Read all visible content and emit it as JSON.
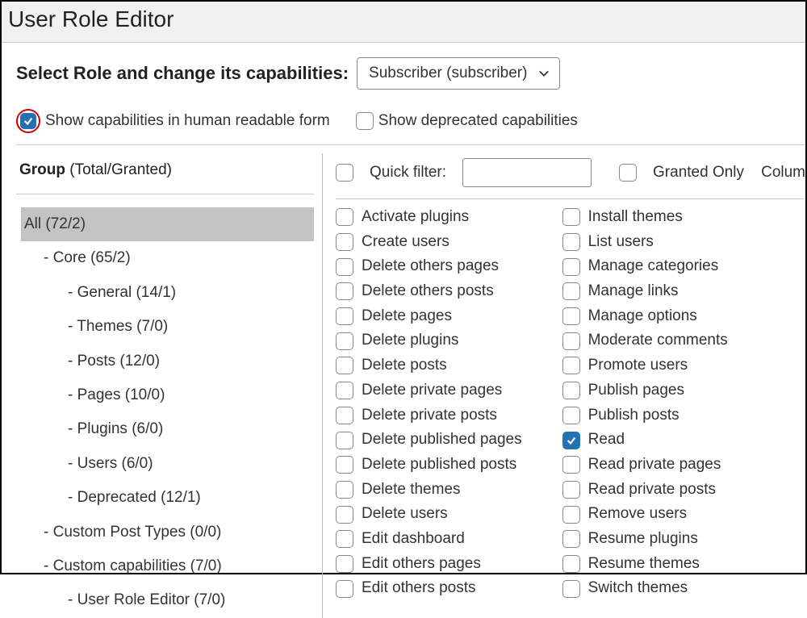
{
  "title": "User Role Editor",
  "roleRow": {
    "label": "Select Role and change its capabilities:",
    "selected": "Subscriber (subscriber)"
  },
  "options": {
    "humanReadable": {
      "label": "Show capabilities in human readable form",
      "checked": true,
      "highlight": true
    },
    "deprecated": {
      "label": "Show deprecated capabilities",
      "checked": false
    }
  },
  "sidebar": {
    "headingBold": "Group",
    "headingLight": " (Total/Granted)",
    "items": [
      {
        "label": "All (72/2)",
        "indent": 0,
        "selected": true
      },
      {
        "label": "- Core (65/2)",
        "indent": 1
      },
      {
        "label": "- General (14/1)",
        "indent": 2
      },
      {
        "label": "- Themes (7/0)",
        "indent": 2
      },
      {
        "label": "- Posts (12/0)",
        "indent": 2
      },
      {
        "label": "- Pages (10/0)",
        "indent": 2
      },
      {
        "label": "- Plugins (6/0)",
        "indent": 2
      },
      {
        "label": "- Users (6/0)",
        "indent": 2
      },
      {
        "label": "- Deprecated (12/1)",
        "indent": 2
      },
      {
        "label": "- Custom Post Types (0/0)",
        "indent": 1
      },
      {
        "label": "- Custom capabilities (7/0)",
        "indent": 1
      },
      {
        "label": "- User Role Editor (7/0)",
        "indent": 2
      }
    ]
  },
  "capsHeader": {
    "selectAllChecked": false,
    "quickFilterLabel": "Quick filter:",
    "quickFilterValue": "",
    "grantedOnlyChecked": false,
    "grantedOnlyLabel": "Granted Only",
    "columnsLabel": "Colum"
  },
  "capabilities": {
    "col1": [
      {
        "label": "Activate plugins",
        "checked": false
      },
      {
        "label": "Create users",
        "checked": false
      },
      {
        "label": "Delete others pages",
        "checked": false
      },
      {
        "label": "Delete others posts",
        "checked": false
      },
      {
        "label": "Delete pages",
        "checked": false
      },
      {
        "label": "Delete plugins",
        "checked": false
      },
      {
        "label": "Delete posts",
        "checked": false
      },
      {
        "label": "Delete private pages",
        "checked": false
      },
      {
        "label": "Delete private posts",
        "checked": false
      },
      {
        "label": "Delete published pages",
        "checked": false
      },
      {
        "label": "Delete published posts",
        "checked": false
      },
      {
        "label": "Delete themes",
        "checked": false
      },
      {
        "label": "Delete users",
        "checked": false
      },
      {
        "label": "Edit dashboard",
        "checked": false
      },
      {
        "label": "Edit others pages",
        "checked": false
      },
      {
        "label": "Edit others posts",
        "checked": false
      }
    ],
    "col2": [
      {
        "label": "Install themes",
        "checked": false
      },
      {
        "label": "List users",
        "checked": false
      },
      {
        "label": "Manage categories",
        "checked": false
      },
      {
        "label": "Manage links",
        "checked": false
      },
      {
        "label": "Manage options",
        "checked": false
      },
      {
        "label": "Moderate comments",
        "checked": false
      },
      {
        "label": "Promote users",
        "checked": false
      },
      {
        "label": "Publish pages",
        "checked": false
      },
      {
        "label": "Publish posts",
        "checked": false
      },
      {
        "label": "Read",
        "checked": true
      },
      {
        "label": "Read private pages",
        "checked": false
      },
      {
        "label": "Read private posts",
        "checked": false
      },
      {
        "label": "Remove users",
        "checked": false
      },
      {
        "label": "Resume plugins",
        "checked": false
      },
      {
        "label": "Resume themes",
        "checked": false
      },
      {
        "label": "Switch themes",
        "checked": false
      }
    ]
  }
}
